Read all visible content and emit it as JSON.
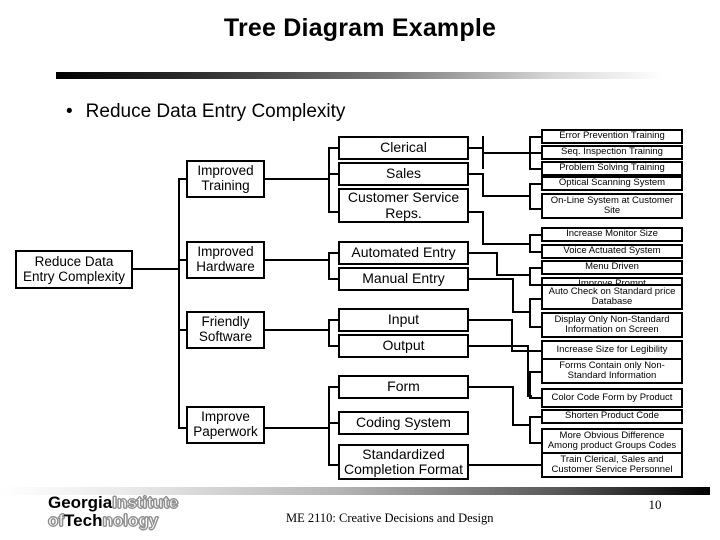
{
  "slide": {
    "title": "Tree Diagram Example",
    "bullet_glyph": "•",
    "bullet_text": "Reduce Data Entry Complexity",
    "page_number": "10",
    "footer_text": "ME 2110: Creative Decisions and Design",
    "logo": {
      "line1_solid": "Georgia",
      "line1_hollow": "Institute",
      "line2_hollow_a": "of",
      "line2_solid": "Tech",
      "line2_hollow_b": "nology"
    },
    "colors": {
      "ink": "#000000",
      "paper": "#ffffff",
      "rule_dark": "#000000",
      "rule_light": "#ffffff"
    }
  },
  "chart_data": {
    "type": "tree",
    "title": "Tree Diagram Example",
    "root": "Reduce Data Entry Complexity",
    "levels": 4,
    "nodes": {
      "level1": [
        "Reduce Data Entry Complexity"
      ],
      "level2": [
        "Improved Training",
        "Improved Hardware",
        "Friendly Software",
        "Improve Paperwork"
      ],
      "level3": [
        "Clerical",
        "Sales",
        "Customer Service Reps.",
        "Automated Entry",
        "Manual Entry",
        "Input",
        "Output",
        "Form",
        "Coding System",
        "Standardized Completion Format"
      ],
      "level4": [
        "Error Prevention Training",
        "Seq. Inspection Training",
        "Problem Solving Training",
        "Optical Scanning System",
        "On-Line System at Customer Site",
        "Increase Monitor Size",
        "Voice Actuated System",
        "Menu Driven",
        "Improve Prompt",
        "Auto Check on Standard price Database",
        "Display Only Non-Standard Information on Screen",
        "Increase Size for Legibility",
        "Forms Contain only Non-Standard Information",
        "Color Code Form by Product",
        "Shorten Product Code",
        "More Obvious Difference Among product Groups Codes",
        "Train Clerical, Sales and Customer Service Personnel"
      ]
    }
  },
  "tree": {
    "root": {
      "label": "Reduce Data Entry Complexity"
    },
    "branches": [
      {
        "label": "Improved Training",
        "children": [
          {
            "label": "Clerical",
            "leaves": [
              "Error Prevention Training",
              "Seq. Inspection Training",
              "Problem Solving Training"
            ]
          },
          {
            "label": "Sales",
            "leaves": [
              "Optical Scanning System",
              "On-Line System at Customer Site"
            ]
          },
          {
            "label": "Customer Service Reps.",
            "leaves": [
              "Increase Monitor Size",
              "Voice Actuated System"
            ]
          }
        ]
      },
      {
        "label": "Improved Hardware",
        "children": [
          {
            "label": "Automated Entry",
            "leaves": [
              "Menu Driven",
              "Improve Prompt"
            ]
          },
          {
            "label": "Manual Entry",
            "leaves": [
              "Auto Check on Standard price Database",
              "Display Only Non-Standard Information on Screen"
            ]
          }
        ]
      },
      {
        "label": "Friendly Software",
        "children": [
          {
            "label": "Input",
            "leaves": [
              "Increase Size for Legibility"
            ]
          },
          {
            "label": "Output",
            "leaves": [
              "Forms Contain only Non-Standard Information",
              "Color Code Form by Product"
            ]
          }
        ]
      },
      {
        "label": "Improve Paperwork",
        "children": [
          {
            "label": "Form",
            "leaves": [
              "Shorten Product Code",
              "More Obvious Difference Among product Groups Codes"
            ]
          },
          {
            "label": "Coding System",
            "leaves": []
          },
          {
            "label": "Standardized Completion Format",
            "leaves": [
              "Train Clerical, Sales and Customer Service Personnel"
            ]
          }
        ]
      }
    ],
    "nodes_level3": [
      "Clerical",
      "Sales",
      "Customer Service Reps.",
      "Automated Entry",
      "Manual Entry",
      "Input",
      "Output",
      "Form",
      "Coding System",
      "Standardized Completion Format"
    ],
    "nodes_level4": [
      "Error Prevention Training",
      "Seq. Inspection Training",
      "Problem Solving Training",
      "Optical Scanning System",
      "On-Line System at Customer Site",
      "Increase Monitor Size",
      "Voice Actuated System",
      "Menu Driven",
      "Improve Prompt",
      "Auto Check on Standard price Database",
      "Display Only Non-Standard Information on Screen",
      "Increase Size for Legibility",
      "Forms Contain only Non-Standard Information",
      "Color Code Form by Product",
      "Shorten Product Code",
      "More Obvious Difference Among product Groups Codes",
      "Train Clerical, Sales and Customer Service Personnel"
    ]
  }
}
